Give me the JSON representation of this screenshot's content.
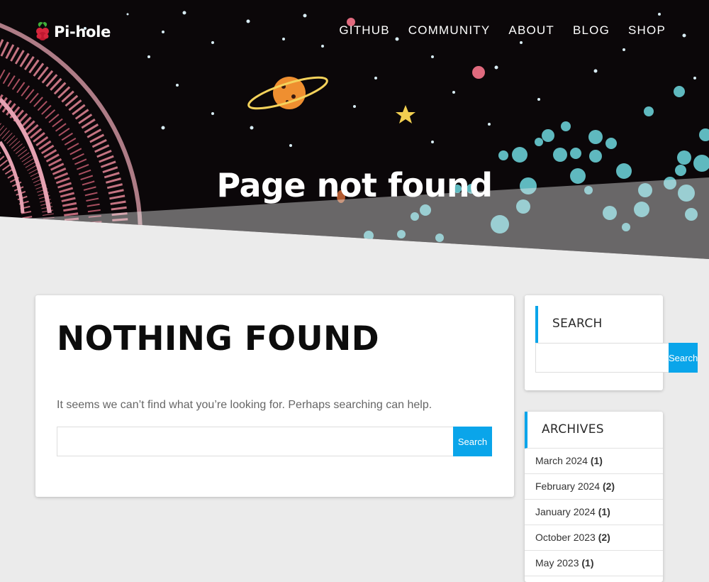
{
  "site": {
    "logo_text": "Pi-hole"
  },
  "nav": {
    "items": [
      "GITHUB",
      "COMMUNITY",
      "ABOUT",
      "BLOG",
      "SHOP"
    ]
  },
  "hero": {
    "title": "Page not found"
  },
  "main": {
    "heading": "NOTHING FOUND",
    "message": "It seems we can’t find what you’re looking for. Perhaps searching can help.",
    "search_value": "",
    "search_button": "Search"
  },
  "sidebar": {
    "search_widget": {
      "title": "SEARCH",
      "search_value": "",
      "search_button": "Search"
    },
    "archives": {
      "title": "ARCHIVES",
      "items": [
        {
          "month": "March 2024",
          "count": "(1)"
        },
        {
          "month": "February 2024",
          "count": "(2)"
        },
        {
          "month": "January 2024",
          "count": "(1)"
        },
        {
          "month": "October 2023",
          "count": "(2)"
        },
        {
          "month": "May 2023",
          "count": "(1)"
        }
      ]
    }
  },
  "colors": {
    "accent": "#0aa5ea",
    "hero_background": "#0b0709",
    "page_background": "#ebebeb",
    "teal_dots": "#5fb9bf",
    "pink_rings": "#c06a7a"
  }
}
